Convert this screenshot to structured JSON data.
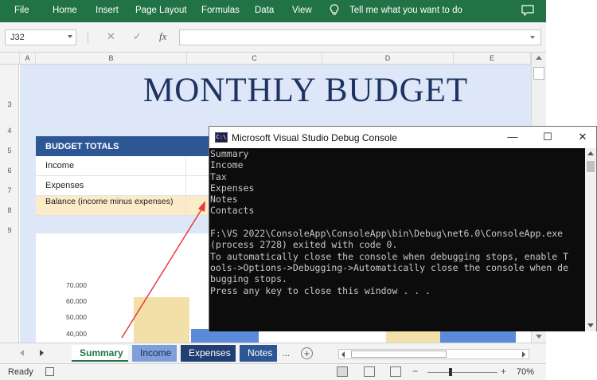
{
  "ribbon": {
    "tabs": [
      "File",
      "Home",
      "Insert",
      "Page Layout",
      "Formulas",
      "Data",
      "View"
    ],
    "tell_me": "Tell me what you want to do",
    "bg_color": "#217346"
  },
  "formula_bar": {
    "name_box": "J32",
    "fx": "fx",
    "cancel": "✕",
    "enter": "✓",
    "formula": ""
  },
  "columns": [
    "A",
    "B",
    "C",
    "D",
    "E"
  ],
  "rows": [
    "3",
    "4",
    "5",
    "6",
    "7",
    "8",
    "9"
  ],
  "sheet": {
    "title": "MONTHLY BUDGET",
    "totals_header": "BUDGET TOTALS",
    "totals_rows": [
      "Income",
      "Expenses",
      "Balance (income minus expenses)"
    ],
    "chart_yticks": [
      "70,000",
      "60,000",
      "50,000",
      "40,000"
    ]
  },
  "sheet_tabs": [
    "Summary",
    "Income",
    "Expenses",
    "Notes"
  ],
  "active_tab": "Summary",
  "tabs_more": "...",
  "add_sheet": "+",
  "status": {
    "ready": "Ready",
    "zoom": "70%",
    "minus": "−",
    "plus": "+"
  },
  "console": {
    "title": "Microsoft Visual Studio Debug Console",
    "icon_text": "C:\\",
    "minimize": "—",
    "maximize": "☐",
    "close": "✕",
    "lines": [
      "Summary",
      "Income",
      "Tax",
      "Expenses",
      "Notes",
      "Contacts",
      "",
      "F:\\VS 2022\\ConsoleApp\\ConsoleApp\\bin\\Debug\\net6.0\\ConsoleApp.exe",
      "(process 2728) exited with code 0.",
      "To automatically close the console when debugging stops, enable T",
      "ools->Options->Debugging->Automatically close the console when de",
      "bugging stops.",
      "Press any key to close this window . . ."
    ]
  },
  "annotation_arrow_color": "#e83a3a"
}
